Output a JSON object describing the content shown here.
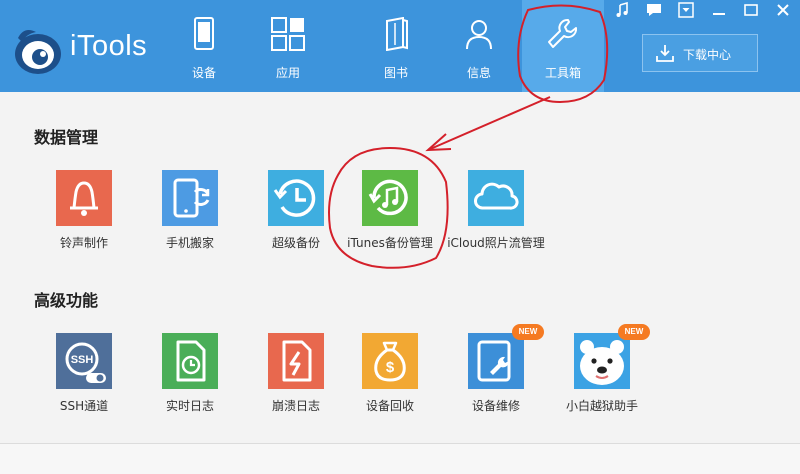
{
  "app": {
    "name": "iTools"
  },
  "nav": {
    "device": "设备",
    "apps": "应用",
    "books": "图书",
    "info": "信息",
    "toolbox": "工具箱"
  },
  "download": {
    "label": "下载中心"
  },
  "sections": {
    "data": {
      "title": "数据管理",
      "tools": [
        "铃声制作",
        "手机搬家",
        "超级备份",
        "iTunes备份管理",
        "iCloud照片流管理"
      ]
    },
    "advanced": {
      "title": "高级功能",
      "tools": [
        "SSH通道",
        "实时日志",
        "崩溃日志",
        "设备回收",
        "设备维修",
        "小白越狱助手"
      ],
      "badge": "NEW"
    }
  },
  "icons": {
    "ssh": "SSH",
    "money": "$"
  },
  "colors": {
    "header": "#3d94dc",
    "active_tab": "#57aaea",
    "ringtone": "#e8684e",
    "migrate": "#4d9be3",
    "backup": "#3eaee0",
    "itunes": "#5dba45",
    "icloud": "#3eaee0",
    "ssh": "#4f6f9a",
    "realtime_log": "#4aae58",
    "crash_log": "#e8684e",
    "recycle": "#f2a833",
    "repair": "#3c8fd8",
    "jailbreak": "#3ba2e4",
    "new_badge": "#f57a22",
    "annotation": "#d4202a"
  }
}
